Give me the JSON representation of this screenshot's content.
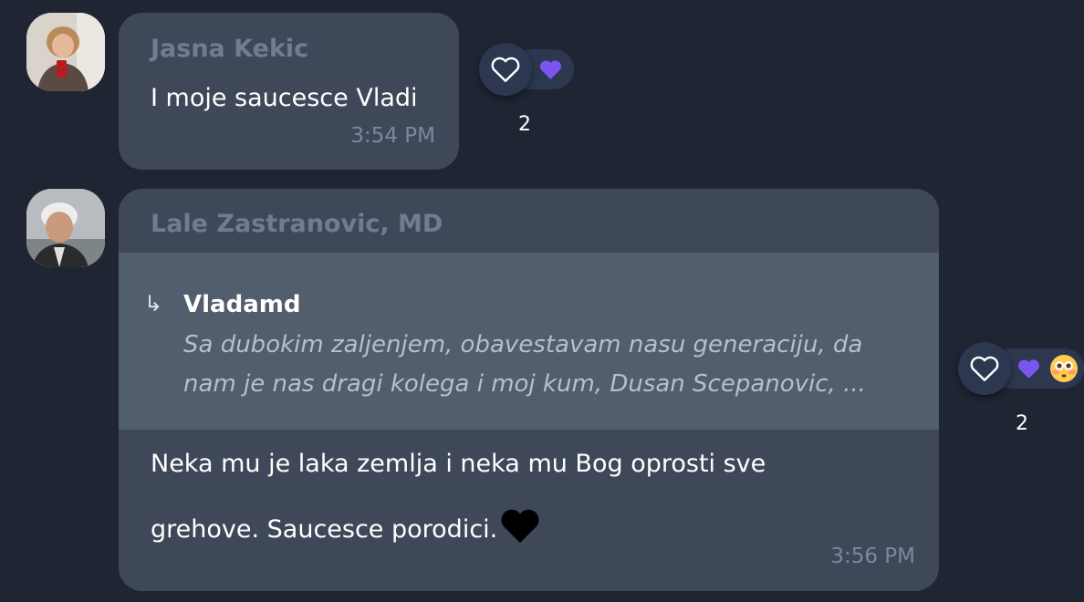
{
  "messages": [
    {
      "sender": "Jasna Kekic",
      "lines": [
        "I moje saucesce Vladi"
      ],
      "time": "3:54 PM",
      "reactions": {
        "count": "2",
        "emojis": [
          "purple-heart"
        ]
      }
    },
    {
      "sender": "Lale Zastranovic, MD",
      "quote": {
        "arrow": "↳",
        "author": "Vladamd",
        "lines": [
          "Sa dubokim zaljenjem, obavestavam nasu generaciju,  da",
          "nam je nas dragi kolega i moj kum, Dusan Scepanovic, ..."
        ]
      },
      "lines": [
        "Neka mu je laka zemlja i neka mu Bog oprosti sve",
        "grehove. Saucesce porodici."
      ],
      "time": "3:56 PM",
      "reactions": {
        "count": "2",
        "emojis": [
          "purple-heart",
          "flushed-face"
        ]
      }
    }
  ],
  "colors": {
    "background": "#1f2533",
    "bubble": "#3f4859",
    "quote_bg": "#525d6d",
    "sender_name": "#6f7d93",
    "timestamp": "#7c889b",
    "reaction_pill": "#2d3850",
    "purple_heart": "#7b55f0"
  }
}
